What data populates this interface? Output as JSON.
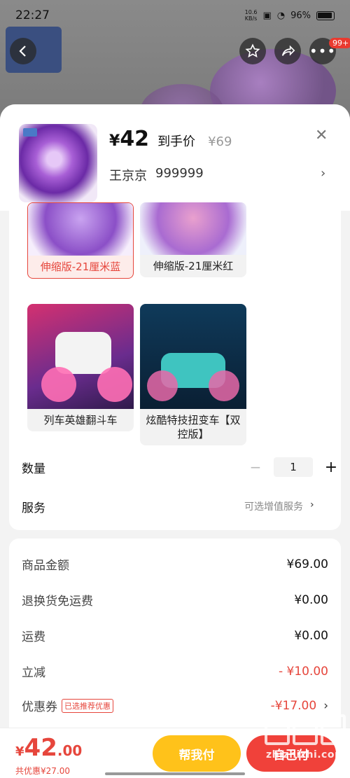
{
  "status": {
    "time": "22:27",
    "net_speed": "10.6",
    "net_unit": "KB/s",
    "battery": "96%"
  },
  "nav": {
    "badge": "99+"
  },
  "product": {
    "currency": "¥",
    "price": "42",
    "price_label": "到手价",
    "original_price": "¥69",
    "shop": "王京京",
    "shop_id": "999999"
  },
  "variants": [
    {
      "label": "伸缩版-21厘米蓝",
      "selected": true
    },
    {
      "label": "伸缩版-21厘米红",
      "selected": false
    },
    {
      "label": "列车英雄翻斗车",
      "selected": false
    },
    {
      "label": "炫酷特技扭变车【双控版】",
      "selected": false
    }
  ],
  "quantity": {
    "label": "数量",
    "minus": "−",
    "value": "1",
    "plus": "+"
  },
  "service": {
    "label": "服务",
    "link": "可选增值服务"
  },
  "summary": {
    "goods_label": "商品金额",
    "goods_value": "¥69.00",
    "return_label": "退换货免运费",
    "return_value": "¥0.00",
    "shipping_label": "运费",
    "shipping_value": "¥0.00",
    "discount_label": "立减",
    "discount_value": "- ¥10.00",
    "coupon_label": "优惠券",
    "coupon_tag": "已选推荐优惠",
    "coupon_value": "-¥17.00"
  },
  "bottom": {
    "currency": "¥",
    "total_int": "42",
    "total_dec": ".00",
    "discount_text": "共优惠¥27.00",
    "help_pay": "帮我付",
    "pay": "自己付"
  },
  "colors": {
    "accent_red": "#e6463c",
    "help_yellow": "#ffc21a",
    "pay_red": "#f0413a"
  }
}
